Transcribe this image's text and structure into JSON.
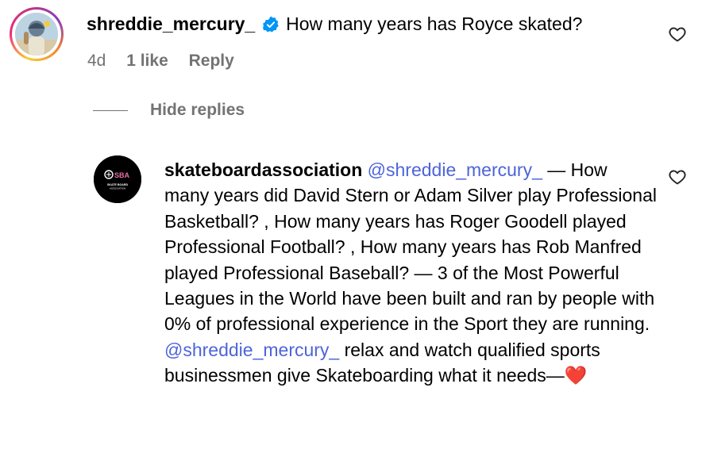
{
  "comment": {
    "username": "shreddie_mercury_",
    "verified": true,
    "text": "How many years has Royce skated?",
    "time": "4d",
    "likes": "1 like",
    "reply_label": "Reply",
    "avatar_icon": "profile-photo",
    "like_icon": "heart-outline-icon"
  },
  "hide_replies_label": "Hide replies",
  "reply": {
    "username": "skateboardassociation",
    "avatar_logo_text": "SBA",
    "avatar_logo_sub": "SKATE BOARD ASSOCIATION",
    "segments": [
      {
        "t": "mention",
        "v": "@shreddie_mercury_"
      },
      {
        "t": "text",
        "v": " — How many years did David Stern or Adam Silver play Professional Basketball? , How many years has Roger Goodell played Professional Football? , How many years has Rob Manfred played Professional Baseball? — 3 of the Most Powerful Leagues in the World have been built and ran by people with 0% of professional experience in the Sport they are running. "
      },
      {
        "t": "mention",
        "v": "@shreddie_mercury_"
      },
      {
        "t": "text",
        "v": " relax and watch qualified sports businessmen give Skateboarding what it needs—"
      },
      {
        "t": "emoji",
        "v": "❤️"
      }
    ],
    "like_icon": "heart-outline-icon"
  },
  "colors": {
    "meta_gray": "#737373",
    "mention_blue": "#4d64d9",
    "verified_blue": "#0095f6",
    "heart_red": "#e3283c"
  }
}
